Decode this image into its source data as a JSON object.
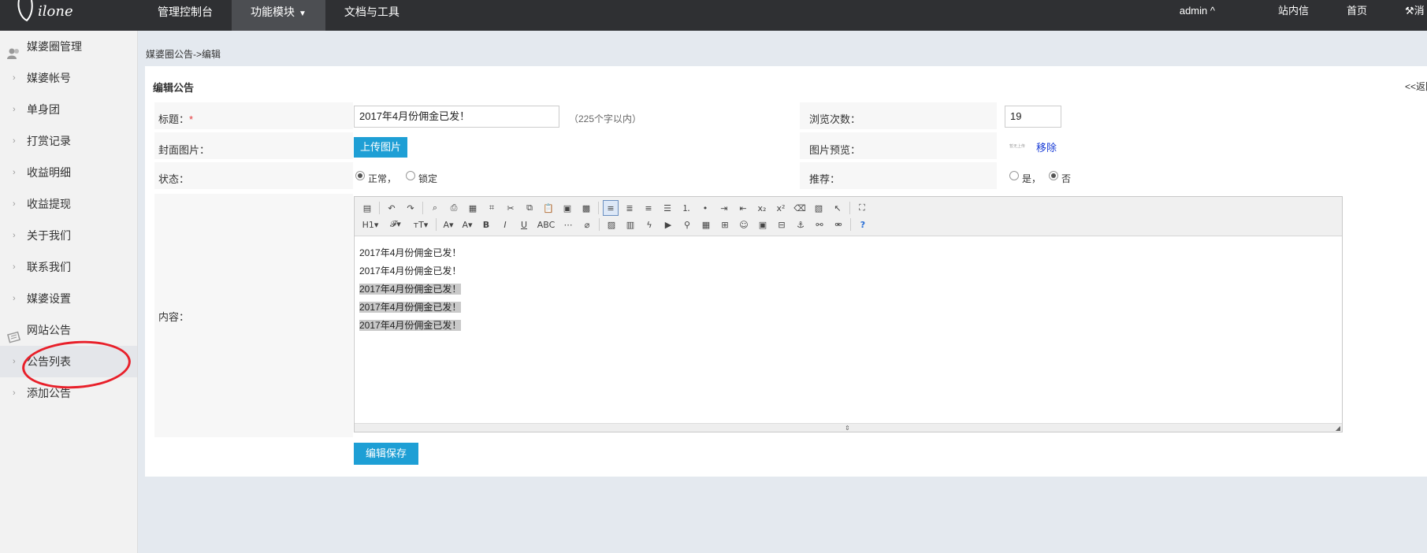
{
  "topbar": {
    "logo_text": "Milone",
    "nav": [
      {
        "label": "管理控制台"
      },
      {
        "label": "功能模块"
      },
      {
        "label": "文档与工具"
      }
    ],
    "user": "admin ^",
    "messages": "站内信",
    "home": "首页",
    "extra": "消"
  },
  "sidebar": {
    "groups": [
      {
        "label": "媒婆圈管理",
        "icon": "users-icon",
        "items": [
          "媒婆帐号",
          "单身团",
          "打赏记录",
          "收益明细",
          "收益提现",
          "关于我们",
          "联系我们",
          "媒婆设置"
        ]
      },
      {
        "label": "网站公告",
        "icon": "notice-icon",
        "items": [
          "公告列表",
          "添加公告"
        ]
      }
    ],
    "active_item": "公告列表"
  },
  "breadcrumb": "媒婆圈公告->编辑",
  "form": {
    "title": "编辑公告",
    "back": "<<返回",
    "fields": {
      "title_label": "标题：",
      "title_required": "*",
      "title_value": "2017年4月份佣金已发！",
      "title_hint": "（225个字以内）",
      "views_label": "浏览次数：",
      "views_value": "19",
      "cover_label": "封面图片：",
      "upload_label": "上传图片",
      "preview_label": "图片预览：",
      "preview_thumb": "暂无上传",
      "remove_label": "移除",
      "status_label": "状态：",
      "status_normal": "正常，",
      "status_locked": "锁定",
      "status_selected": "正常",
      "recommend_label": "推荐：",
      "recommend_yes": "是，",
      "recommend_no": "否",
      "recommend_selected": "否",
      "content_label": "内容："
    },
    "content_lines": [
      {
        "text": "2017年4月份佣金已发！",
        "highlighted": false
      },
      {
        "text": "2017年4月份佣金已发！",
        "highlighted": false
      },
      {
        "text": "2017年4月份佣金已发！",
        "highlighted": true
      },
      {
        "text": "2017年4月份佣金已发！",
        "highlighted": true
      },
      {
        "text": "2017年4月份佣金已发！",
        "highlighted": true
      }
    ],
    "save_label": "编辑保存"
  },
  "toolbar": {
    "row1": [
      "source-icon",
      "|",
      "undo-icon",
      "redo-icon",
      "|",
      "preview-icon",
      "print-icon",
      "template-icon",
      "code-icon",
      "cut-icon",
      "copy-icon",
      "paste-icon",
      "paste-text-icon",
      "paste-word-icon",
      "|",
      "align-left-icon",
      "align-center-icon",
      "align-right-icon",
      "align-justify-icon",
      "ordered-list-icon",
      "unordered-list-icon",
      "indent-icon",
      "outdent-icon",
      "subscript-icon",
      "superscript-icon",
      "clear-format-icon",
      "select-all-icon",
      "pointer-icon",
      "|",
      "fullscreen-icon"
    ],
    "row2": [
      "H1▾",
      "𝓕▾",
      "тT▾",
      "|",
      "A▾",
      "A▾",
      "B",
      "I",
      "U",
      "ABC",
      "hr-icon",
      "eraser-icon",
      "|",
      "image-icon",
      "multi-image-icon",
      "flash-icon",
      "media-icon",
      "attach-icon",
      "table-icon",
      "insert-row-icon",
      "emoticon-icon",
      "gallery-icon",
      "pagebreak-icon",
      "anchor-icon",
      "link-icon",
      "unlink-icon",
      "|",
      "help-icon"
    ]
  },
  "colors": {
    "accent": "#1e9fd5",
    "topbar": "#2f3033",
    "annotation": "#e8202a"
  }
}
